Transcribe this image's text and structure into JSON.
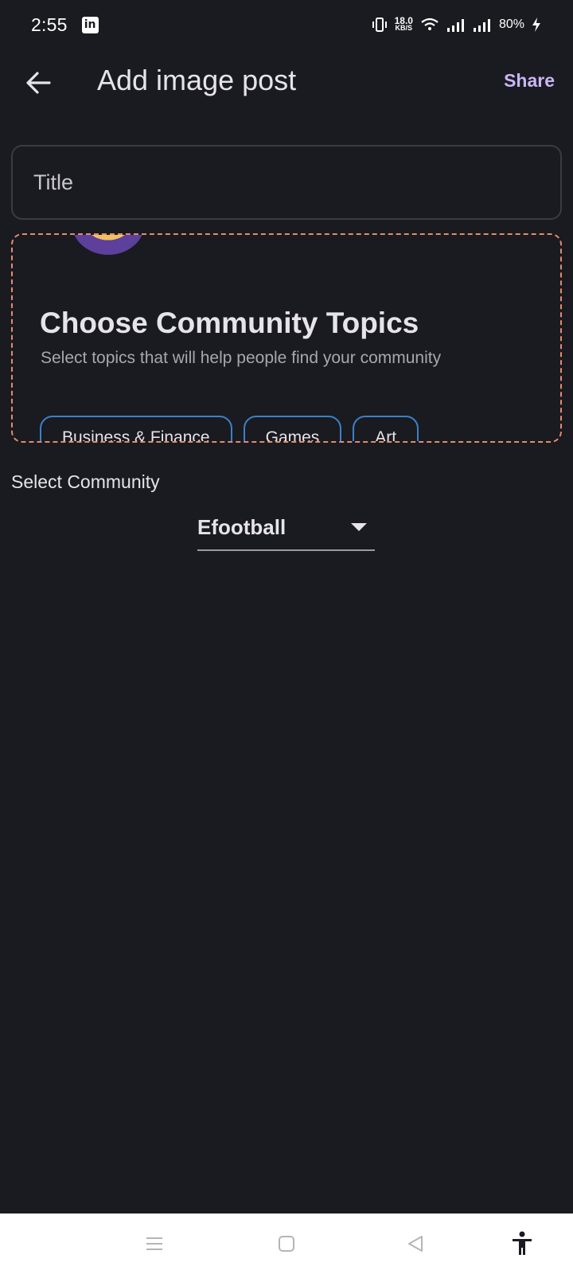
{
  "status_bar": {
    "time": "2:55",
    "speed_value": "18.0",
    "speed_unit": "KB/S",
    "battery": "80%"
  },
  "app_bar": {
    "title": "Add image post",
    "share_label": "Share"
  },
  "title_input": {
    "placeholder": "Title",
    "value": ""
  },
  "topics_card": {
    "heading": "Choose Community Topics",
    "subtitle": "Select topics that will help people find your community",
    "chips": [
      "Business & Finance",
      "Games",
      "Art"
    ]
  },
  "community": {
    "label": "Select Community",
    "selected": "Efootball"
  },
  "colors": {
    "background": "#1a1a21",
    "accent": "#c9b6f2",
    "dashed_border": "#e38d6a",
    "chip_border": "#3a82c7"
  }
}
